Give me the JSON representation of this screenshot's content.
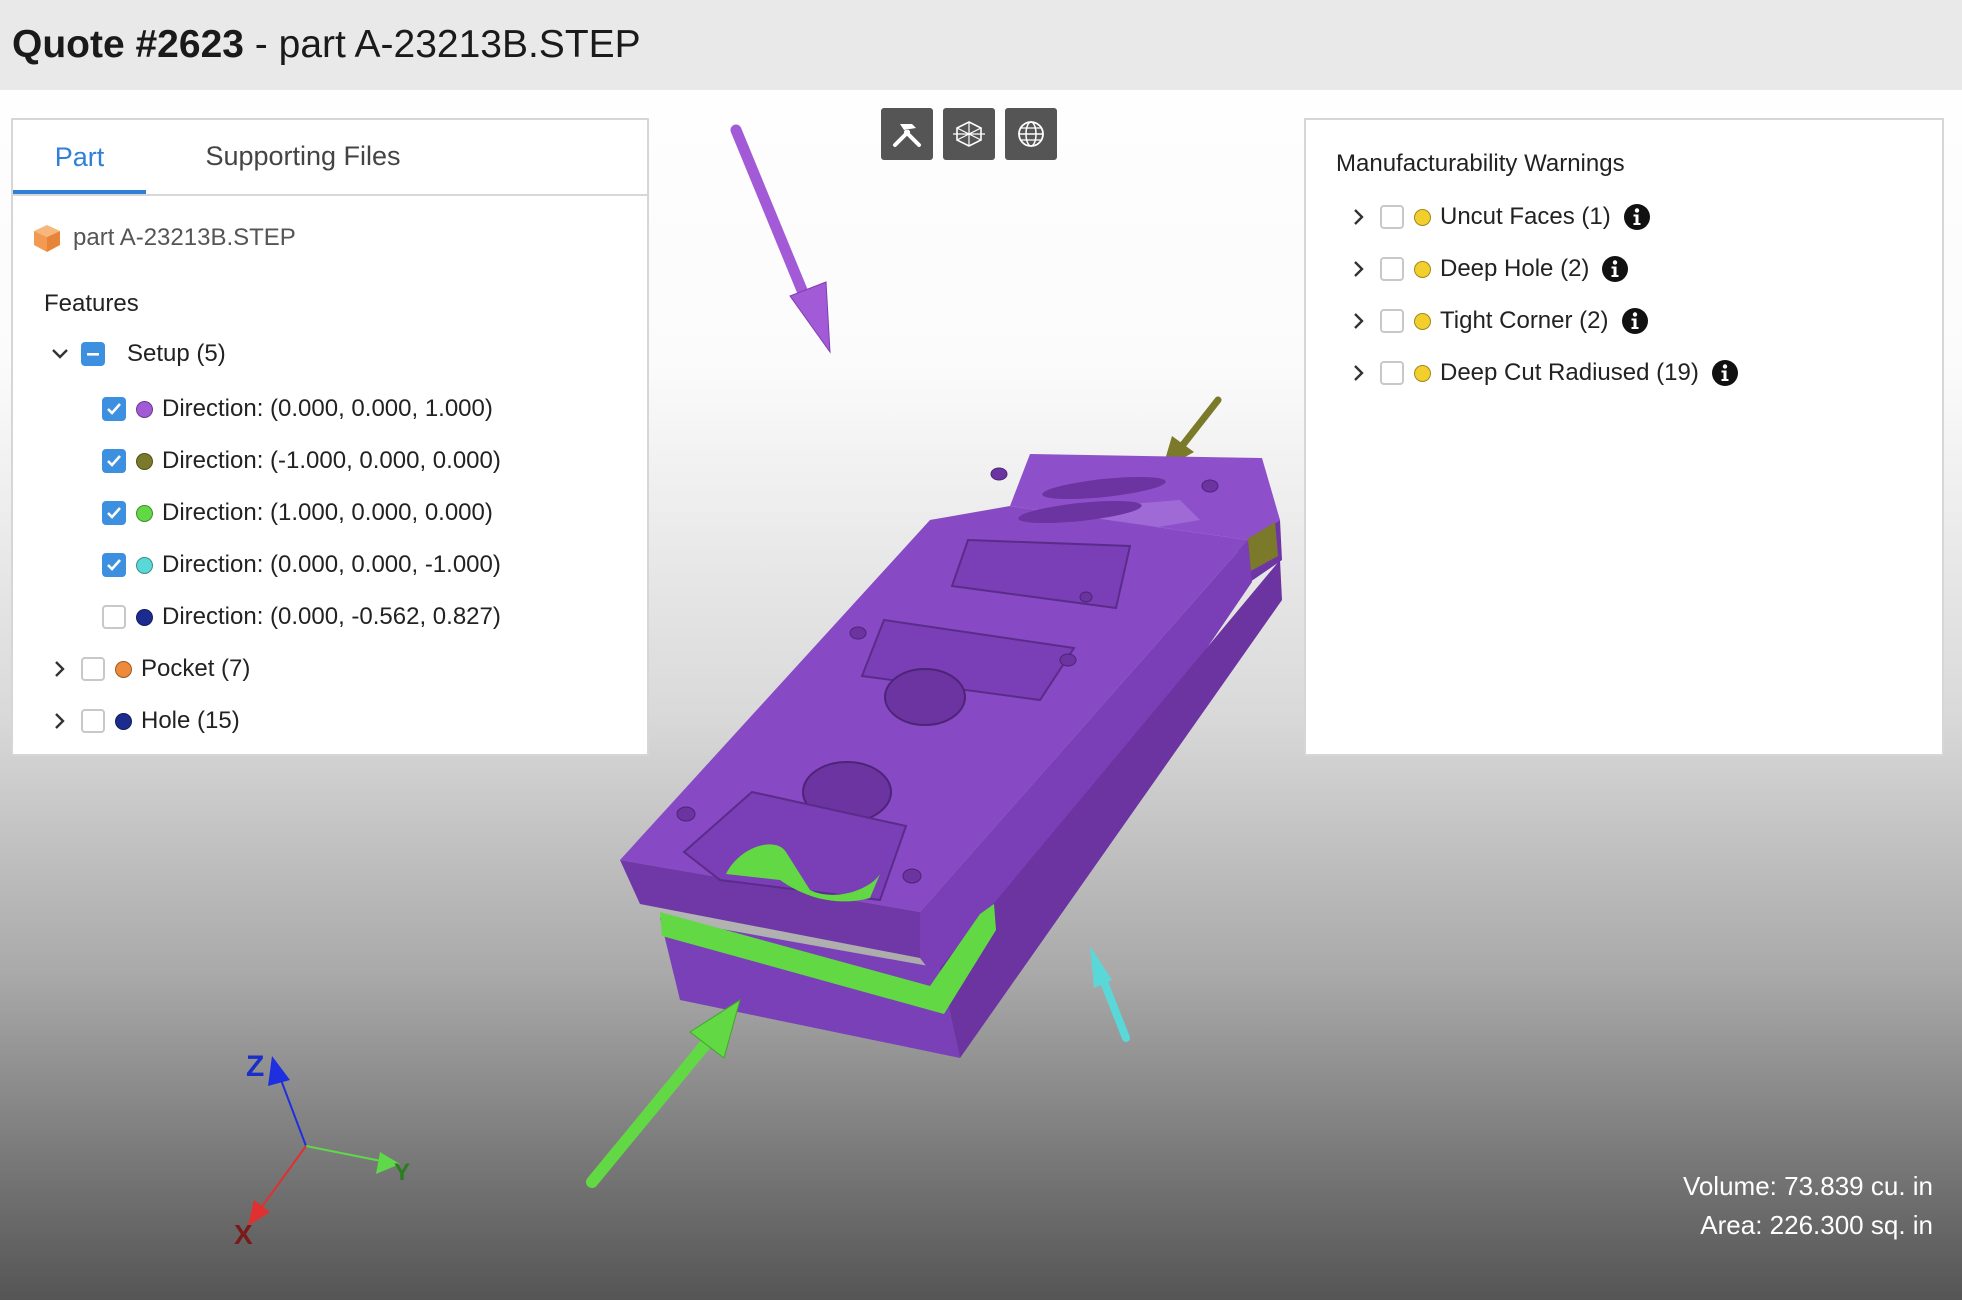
{
  "header": {
    "quote_label": "Quote #2623",
    "separator": " - ",
    "part_label": "part A-23213B.STEP"
  },
  "left_panel": {
    "tabs": [
      {
        "label": "Part",
        "active": true
      },
      {
        "label": "Supporting Files",
        "active": false
      }
    ],
    "file_name": "part A-23213B.STEP",
    "file_icon": "cube-icon",
    "features_heading": "Features",
    "setup": {
      "label": "Setup (5)",
      "expanded": true,
      "state": "partial",
      "directions": [
        {
          "label": "Direction: (0.000, 0.000, 1.000)",
          "checked": true,
          "color": "#a35ad6"
        },
        {
          "label": "Direction: (-1.000, 0.000, 0.000)",
          "checked": true,
          "color": "#7b7a2a"
        },
        {
          "label": "Direction: (1.000, 0.000, 0.000)",
          "checked": true,
          "color": "#62d845"
        },
        {
          "label": "Direction: (0.000, 0.000, -1.000)",
          "checked": true,
          "color": "#5ad8d8"
        },
        {
          "label": "Direction: (0.000, -0.562, 0.827)",
          "checked": false,
          "color": "#1b2c8e"
        }
      ]
    },
    "pocket": {
      "label": "Pocket (7)",
      "checked": false,
      "color": "#ee8a3a"
    },
    "hole": {
      "label": "Hole (15)",
      "checked": false,
      "color": "#1b2c8e"
    }
  },
  "right_panel": {
    "heading": "Manufacturability Warnings",
    "warnings": [
      {
        "label": "Uncut Faces (1)",
        "checked": false,
        "color": "#f3cf2d"
      },
      {
        "label": "Deep Hole (2)",
        "checked": false,
        "color": "#f3cf2d"
      },
      {
        "label": "Tight Corner (2)",
        "checked": false,
        "color": "#f3cf2d"
      },
      {
        "label": "Deep Cut Radiused (19)",
        "checked": false,
        "color": "#f3cf2d"
      }
    ]
  },
  "toolbar": {
    "buttons": [
      {
        "icon": "measure-tools-icon"
      },
      {
        "icon": "wireframe-cube-icon"
      },
      {
        "icon": "globe-icon"
      }
    ]
  },
  "axes": {
    "z": "Z",
    "y": "Y",
    "x": "X"
  },
  "colors": {
    "part": "#8849c4",
    "setup_top": "#a35ad6",
    "setup_neg_x": "#7b7a2a",
    "setup_pos_x": "#62d845",
    "setup_neg_z": "#5ad8d8",
    "accent": "#2f80d6"
  },
  "stats": {
    "volume": "Volume: 73.839 cu. in",
    "area": "Area: 226.300 sq. in"
  }
}
